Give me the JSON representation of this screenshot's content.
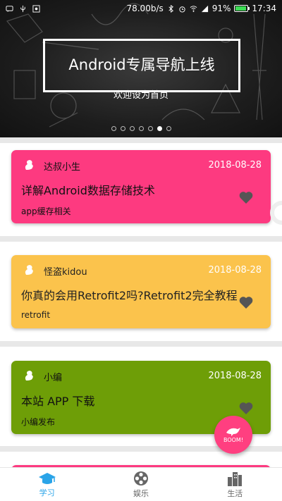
{
  "status_bar": {
    "speed": "78.00b/s",
    "battery": "91%",
    "battery_level": 0.91,
    "time": "17:34"
  },
  "banner": {
    "title": "Android专属导航上线",
    "subtitle": "欢迎设为首页",
    "page_count": 7,
    "active_index": 5
  },
  "posts": [
    {
      "author": "达叔小生",
      "date": "2018-08-28",
      "title": "详解Android数据存储技术",
      "tag": "app缓存相关",
      "color": "#fd3a80",
      "text_color": "#111111"
    },
    {
      "author": "怪盗kidou",
      "date": "2018-08-28",
      "title": "你真的会用Retrofit2吗?Retrofit2完全教程",
      "tag": "retrofit",
      "color": "#fbc34c",
      "text_color": "#222222"
    },
    {
      "author": "小编",
      "date": "2018-08-28",
      "title": "本站 APP 下载",
      "tag": "小编发布",
      "color": "#6e9e07",
      "text_color": "#111111"
    }
  ],
  "fab": {
    "label": "BOOM!",
    "color": "#ff3f80"
  },
  "bottom_nav": [
    {
      "label": "学习",
      "icon": "graduation-cap-icon",
      "active": true
    },
    {
      "label": "娱乐",
      "icon": "film-reel-icon",
      "active": false
    },
    {
      "label": "生活",
      "icon": "city-buildings-icon",
      "active": false
    }
  ],
  "colors": {
    "accent": "#2aa4e8",
    "heart": "#555555"
  }
}
